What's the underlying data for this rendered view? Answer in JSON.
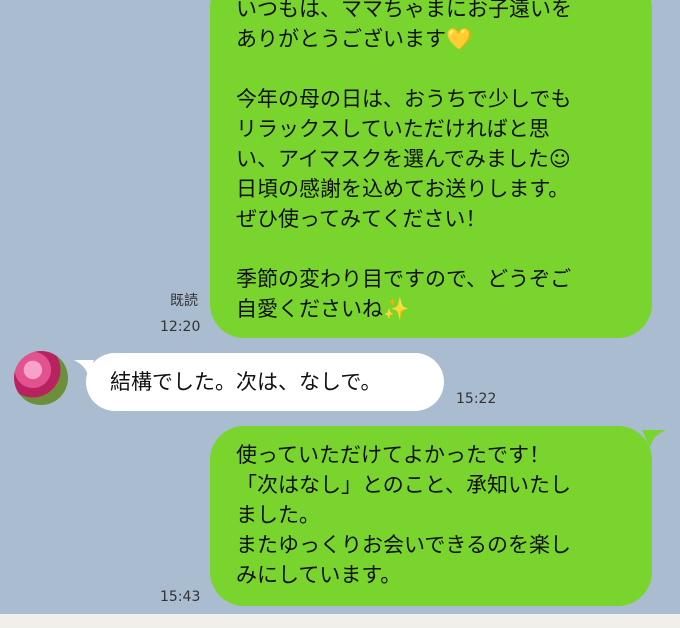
{
  "messages": [
    {
      "direction": "outgoing",
      "lines": [
        "いつもは、ママちゃまにお子遠いを",
        "ありがとうございます💛",
        "",
        "今年の母の日は、おうちで少しでも",
        "リラックスしていただければと思",
        "い、アイマスクを選んでみました☺",
        "日頃の感謝を込めてお送りします。",
        "ぜひ使ってみてください！",
        "",
        "季節の変わり目ですので、どうぞご",
        "自愛くださいね✨"
      ],
      "read_status": "既読",
      "time": "12:20"
    },
    {
      "direction": "incoming",
      "lines": [
        "結構でした。次は、なしで。"
      ],
      "time": "15:22"
    },
    {
      "direction": "outgoing",
      "lines": [
        "使っていただけてよかったです！",
        "「次はなし」とのこと、承知いたし",
        "ました。",
        "またゆっくりお会いできるのを楽し",
        "みにしています。"
      ],
      "time": "15:43"
    }
  ],
  "colors": {
    "background": "#a9bcd0",
    "outgoing_bubble": "#7ad42e",
    "incoming_bubble": "#ffffff"
  }
}
